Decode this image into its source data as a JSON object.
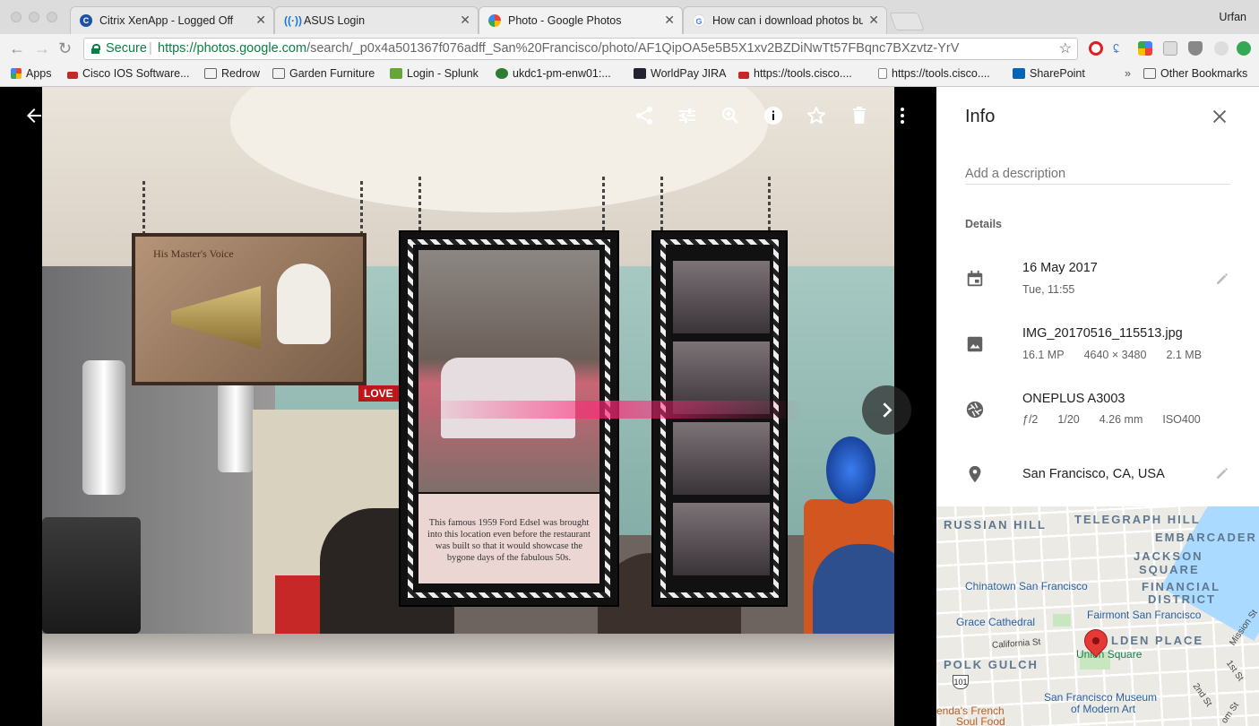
{
  "browser": {
    "tabs": [
      {
        "title": "Citrix XenApp - Logged Off",
        "icon_color": "#1f4fa8"
      },
      {
        "title": "ASUS Login",
        "icon_color": "#1976d2"
      },
      {
        "title": "Photo - Google Photos",
        "icon_color": "#fbbc05"
      },
      {
        "title": "How can i download photos bu",
        "icon_color": "#4285f4"
      }
    ],
    "profile_name": "Urfan",
    "secure_label": "Secure",
    "url_host": "https://photos.google.com",
    "url_path": "/search/_p0x4a501367f076adff_San%20Francisco/photo/AF1QipOA5e5B5X1xv2BZDiNwTt57FBqnc7BXzvtz-YrV",
    "bookmarks": [
      {
        "label": "Apps",
        "icon": "apps-grid-icon"
      },
      {
        "label": "Cisco IOS Software...",
        "icon": "cisco-icon"
      },
      {
        "label": "Redrow",
        "icon": "folder-icon"
      },
      {
        "label": "Garden Furniture",
        "icon": "folder-icon"
      },
      {
        "label": "Login - Splunk",
        "icon": "splunk-icon"
      },
      {
        "label": "ukdc1-pm-enw01:...",
        "icon": "site-icon"
      },
      {
        "label": "WorldPay JIRA",
        "icon": "jira-icon"
      },
      {
        "label": "https://tools.cisco....",
        "icon": "cisco-icon"
      },
      {
        "label": "https://tools.cisco....",
        "icon": "page-icon"
      },
      {
        "label": "SharePoint",
        "icon": "sharepoint-icon"
      },
      {
        "label": "Other Bookmarks",
        "icon": "folder-icon"
      }
    ],
    "more_bookmarks": "»"
  },
  "photo": {
    "sign_title": "His Master's Voice",
    "love_sign": "LOVE",
    "caption": "This famous 1959 Ford Edsel was brought into this location even before the restaurant was built so that it would showcase the bygone days of the fabulous 50s."
  },
  "info": {
    "title": "Info",
    "description_placeholder": "Add a description",
    "details_heading": "Details",
    "date": "16 May 2017",
    "day_time": "Tue, 11:55",
    "filename": "IMG_20170516_115513.jpg",
    "megapixels": "16.1 MP",
    "resolution": "4640 × 3480",
    "filesize": "2.1 MB",
    "camera": "ONEPLUS A3003",
    "aperture": "ƒ/2",
    "shutter": "1/20",
    "focal": "4.26 mm",
    "iso": "ISO400",
    "location": "San Francisco, CA, USA"
  },
  "map": {
    "areas": [
      "RUSSIAN HILL",
      "TELEGRAPH HILL",
      "EMBARCADER",
      "JACKSON",
      "SQUARE",
      "FINANCIAL",
      "DISTRICT",
      "POLK GULCH",
      "LDEN PLACE"
    ],
    "pois": [
      "Chinatown San Francisco",
      "Fairmont San Francisco",
      "Grace Cathedral",
      "Union Square",
      "San Francisco Museum",
      "of Modern Art"
    ],
    "streets": [
      "California St",
      "Mission St",
      "1st St",
      "2nd St",
      "om St"
    ],
    "food": [
      "enda's French",
      "Soul Food"
    ],
    "highway": "101"
  },
  "colors": {
    "secure_green": "#0b8043",
    "pin_red": "#e53935"
  }
}
